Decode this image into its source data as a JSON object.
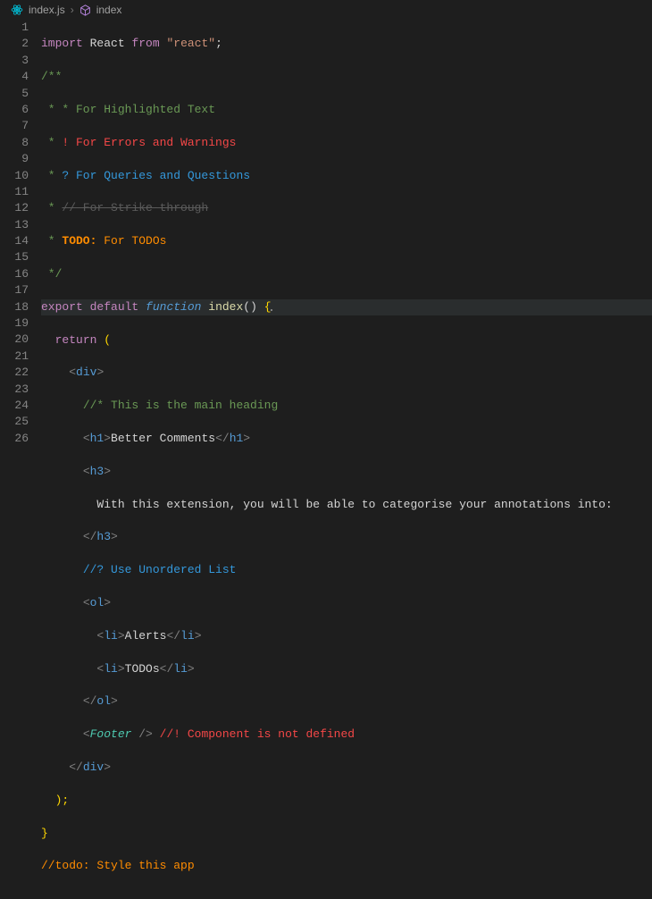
{
  "breadcrumb": {
    "file": "index.js",
    "symbol": "index"
  },
  "colors": {
    "background": "#1e1e1e",
    "gutter": "#858585",
    "commentGreen": "#6a9955",
    "errorRed": "#f44747",
    "infoBlue": "#3498db",
    "strike": "#5a5a5a",
    "todoOrange": "#ff8c00",
    "keyword": "#c586c0",
    "string": "#ce9178",
    "funcword": "#569cd6",
    "funcname": "#dcdcaa",
    "brace": "#ffd700",
    "tag": "#569cd6",
    "tagPunc": "#808080",
    "component": "#4ec9b0"
  },
  "gutter": {
    "start": 1,
    "end": 26
  },
  "tokens": {
    "l1": {
      "import": "import",
      "react": "React",
      "from": "from",
      "str": "\"react\"",
      "semi": ";"
    },
    "l2": "/**",
    "l3": {
      "star": " * ",
      "green": "* For Highlighted Text"
    },
    "l4": {
      "star": " * ",
      "red": "! For Errors and Warnings"
    },
    "l5": {
      "star": " * ",
      "blue": "? For Queries and Questions"
    },
    "l6": {
      "star": " * ",
      "strike": "// For Strike-through"
    },
    "l7": {
      "star": " * ",
      "todo": "TODO:",
      "rest": " For TODOs"
    },
    "l8": " */",
    "l9": {
      "export": "export",
      "default": "default",
      "func": "function",
      "name": "index",
      "paren": "()",
      "brace": "{"
    },
    "l10": {
      "ret": "return",
      "paren": "("
    },
    "l11": {
      "open": "<",
      "tag": "div",
      "close": ">"
    },
    "l12": "//* This is the main heading",
    "l13": {
      "o": "<",
      "t": "h1",
      "c": ">",
      "txt": "Better Comments",
      "o2": "</",
      "t2": "h1",
      "c2": ">"
    },
    "l14": {
      "o": "<",
      "t": "h3",
      "c": ">"
    },
    "l15": "With this extension, you will be able to categorise your annotations into:",
    "l16": {
      "o": "</",
      "t": "h3",
      "c": ">"
    },
    "l17": "//? Use Unordered List",
    "l18": {
      "o": "<",
      "t": "ol",
      "c": ">"
    },
    "l19": {
      "o": "<",
      "t": "li",
      "c": ">",
      "txt": "Alerts",
      "o2": "</",
      "t2": "li",
      "c2": ">"
    },
    "l20": {
      "o": "<",
      "t": "li",
      "c": ">",
      "txt": "TODOs",
      "o2": "</",
      "t2": "li",
      "c2": ">"
    },
    "l21": {
      "o": "</",
      "t": "ol",
      "c": ">"
    },
    "l22": {
      "o": "<",
      "t": "Footer",
      "c": " />",
      "comment": " //! Component is not defined"
    },
    "l23": {
      "o": "</",
      "t": "div",
      "c": ">"
    },
    "l24": ");",
    "l25": "}",
    "l26": "//todo: Style this app"
  }
}
